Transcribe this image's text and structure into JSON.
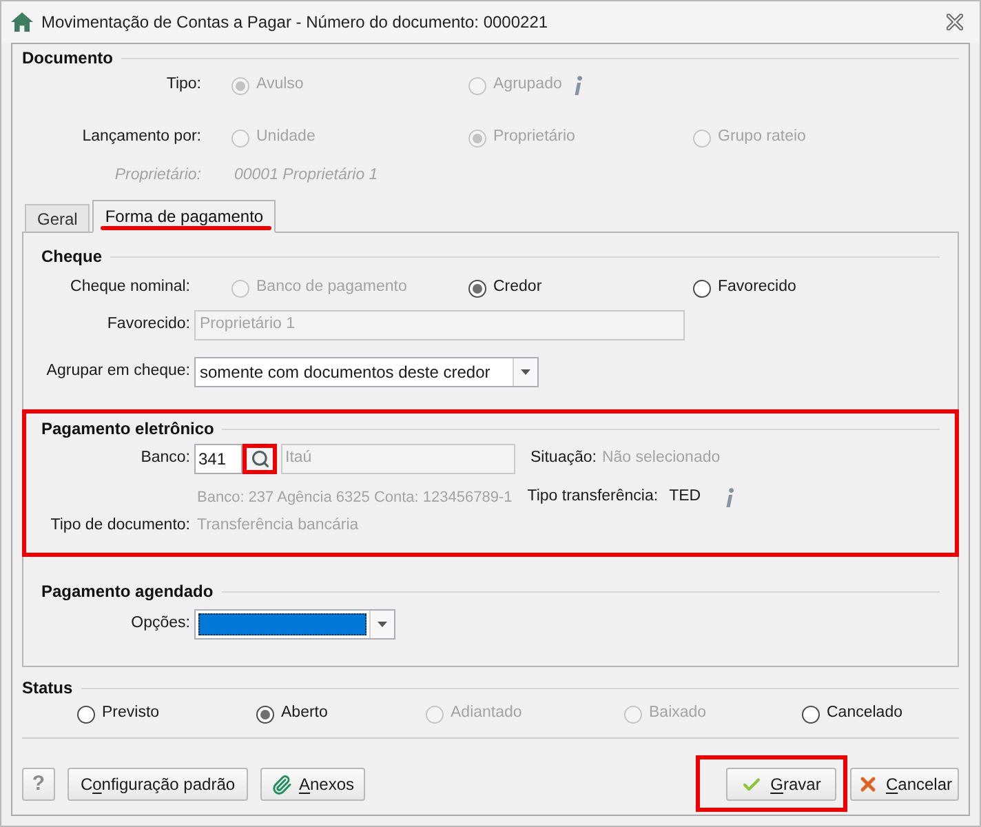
{
  "window": {
    "title": "Movimentação de Contas a Pagar - Número do documento: 0000221"
  },
  "documento": {
    "heading": "Documento",
    "tipo": {
      "label": "Tipo:",
      "options": [
        {
          "label": "Avulso",
          "selected": true,
          "disabled": true
        },
        {
          "label": "Agrupado",
          "selected": false,
          "disabled": true,
          "info": true
        }
      ]
    },
    "lancamento": {
      "label": "Lançamento por:",
      "options": [
        {
          "label": "Unidade",
          "selected": false,
          "disabled": true
        },
        {
          "label": "Proprietário",
          "selected": true,
          "disabled": true
        },
        {
          "label": "Grupo rateio",
          "selected": false,
          "disabled": true
        }
      ]
    },
    "proprietario": {
      "label": "Proprietário:",
      "value": "00001 Proprietário 1",
      "disabled": true
    }
  },
  "tabs": [
    {
      "label": "Geral",
      "selected": false,
      "highlighted": false
    },
    {
      "label": "Forma de pagamento",
      "selected": true,
      "highlighted": true
    }
  ],
  "cheque": {
    "heading": "Cheque",
    "highlighted": false,
    "nominal": {
      "label": "Cheque nominal:",
      "options": [
        {
          "label": "Banco de pagamento",
          "selected": false,
          "disabled": true
        },
        {
          "label": "Credor",
          "selected": true,
          "disabled": false
        },
        {
          "label": "Favorecido",
          "selected": false,
          "disabled": false
        }
      ]
    },
    "favorecido": {
      "label": "Favorecido:",
      "value": "Proprietário 1",
      "disabled": true
    },
    "agrupar": {
      "label": "Agrupar em cheque:",
      "value": "somente com documentos deste credor"
    }
  },
  "pagamento_eletronico": {
    "heading": "Pagamento eletrônico",
    "highlighted": true,
    "banco": {
      "label": "Banco:",
      "code": "341",
      "name": "Itaú",
      "search_highlighted": true
    },
    "situacao": {
      "label": "Situação:",
      "value": "Não selecionado"
    },
    "conta": "Banco: 237 Agência 6325 Conta: 123456789-1",
    "tipo_transferencia": {
      "label": "Tipo transferência:",
      "value": "TED",
      "info": true
    },
    "tipo_documento": {
      "label": "Tipo de documento:",
      "value": "Transferência bancária"
    }
  },
  "pagamento_agendado": {
    "heading": "Pagamento agendado",
    "highlighted": false,
    "opcoes": {
      "label": "Opções:",
      "focused": true
    }
  },
  "status": {
    "heading": "Status",
    "options": [
      {
        "label": "Previsto",
        "selected": false,
        "disabled": false
      },
      {
        "label": "Aberto",
        "selected": true,
        "disabled": false
      },
      {
        "label": "Adiantado",
        "selected": false,
        "disabled": true
      },
      {
        "label": "Baixado",
        "selected": false,
        "disabled": true
      },
      {
        "label": "Cancelado",
        "selected": false,
        "disabled": false
      }
    ]
  },
  "footer": {
    "left": [
      {
        "kind": "help",
        "highlighted": false,
        "label_parts": [
          {
            "text": "?",
            "underlined": false
          }
        ]
      },
      {
        "kind": "defaults",
        "highlighted": false,
        "label_parts": [
          {
            "text": "C",
            "underlined": false
          },
          {
            "text": "o",
            "underlined": true
          },
          {
            "text": "nfiguração padrão",
            "underlined": false
          }
        ]
      },
      {
        "kind": "attachments",
        "highlighted": false,
        "label_parts": [
          {
            "text": "A",
            "underlined": true
          },
          {
            "text": "nexos",
            "underlined": false
          }
        ]
      }
    ],
    "right": [
      {
        "kind": "save",
        "highlighted": true,
        "label_parts": [
          {
            "text": "G",
            "underlined": true
          },
          {
            "text": "ravar",
            "underlined": false
          }
        ]
      },
      {
        "kind": "cancel",
        "highlighted": false,
        "label_parts": [
          {
            "text": "C",
            "underlined": true
          },
          {
            "text": "ancelar",
            "underlined": false
          }
        ]
      }
    ]
  }
}
